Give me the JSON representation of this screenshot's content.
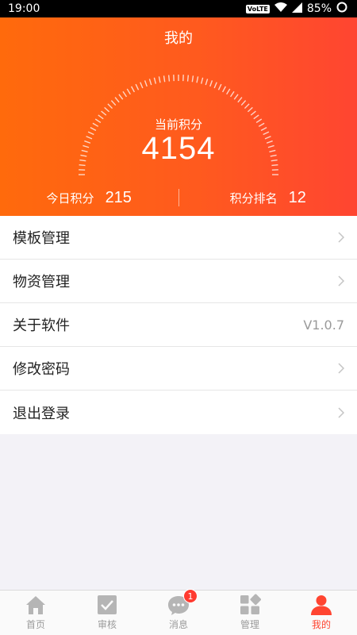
{
  "status_bar": {
    "time": "19:00",
    "network": "VoLTE",
    "battery": "85%"
  },
  "header": {
    "title": "我的",
    "current_points_label": "当前积分",
    "current_points": "4154",
    "today_points_label": "今日积分",
    "today_points": "215",
    "rank_label": "积分排名",
    "rank": "12"
  },
  "menu": {
    "items": [
      {
        "label": "模板管理",
        "value": ""
      },
      {
        "label": "物资管理",
        "value": ""
      },
      {
        "label": "关于软件",
        "value": "V1.0.7"
      },
      {
        "label": "修改密码",
        "value": ""
      },
      {
        "label": "退出登录",
        "value": ""
      }
    ]
  },
  "tabs": [
    {
      "label": "首页",
      "icon": "home-icon"
    },
    {
      "label": "审核",
      "icon": "check-icon"
    },
    {
      "label": "消息",
      "icon": "message-icon",
      "badge": "1"
    },
    {
      "label": "管理",
      "icon": "grid-icon"
    },
    {
      "label": "我的",
      "icon": "person-icon",
      "active": true
    }
  ],
  "colors": {
    "accent": "#ff4531",
    "header_start": "#ff6a0c",
    "header_end": "#ff4531",
    "inactive": "#b5b5b5"
  }
}
